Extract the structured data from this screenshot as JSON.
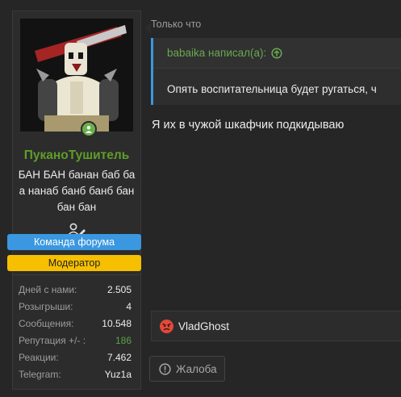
{
  "user": {
    "name": "ПуканоТушитель",
    "title": "БАН БАН банан баб ба а нанаб банб банб бан бан бан",
    "banners": [
      "Команда форума",
      "Модератор"
    ],
    "stats": [
      {
        "label": "Дней с нами:",
        "value": "2.505"
      },
      {
        "label": "Розыгрыши:",
        "value": "4"
      },
      {
        "label": "Сообщения:",
        "value": "10.548"
      },
      {
        "label": "Репутация +/- :",
        "value": "186"
      },
      {
        "label": "Реакции:",
        "value": "7.462"
      },
      {
        "label": "Telegram:",
        "value": "Yuz1a"
      }
    ]
  },
  "post": {
    "time": "Только что",
    "quote": {
      "author": "babaika написал(а):",
      "text": "Опять воспитательница будет ругаться, ч"
    },
    "text": "Я их в чужой шкафчик подкидываю",
    "reactions": {
      "user": "VladGhost"
    },
    "report_label": "Жалоба"
  },
  "colors": {
    "accent": "#3a97e0",
    "username": "#5f9e27",
    "moderator": "#f6c000",
    "positive": "#5aa346"
  }
}
